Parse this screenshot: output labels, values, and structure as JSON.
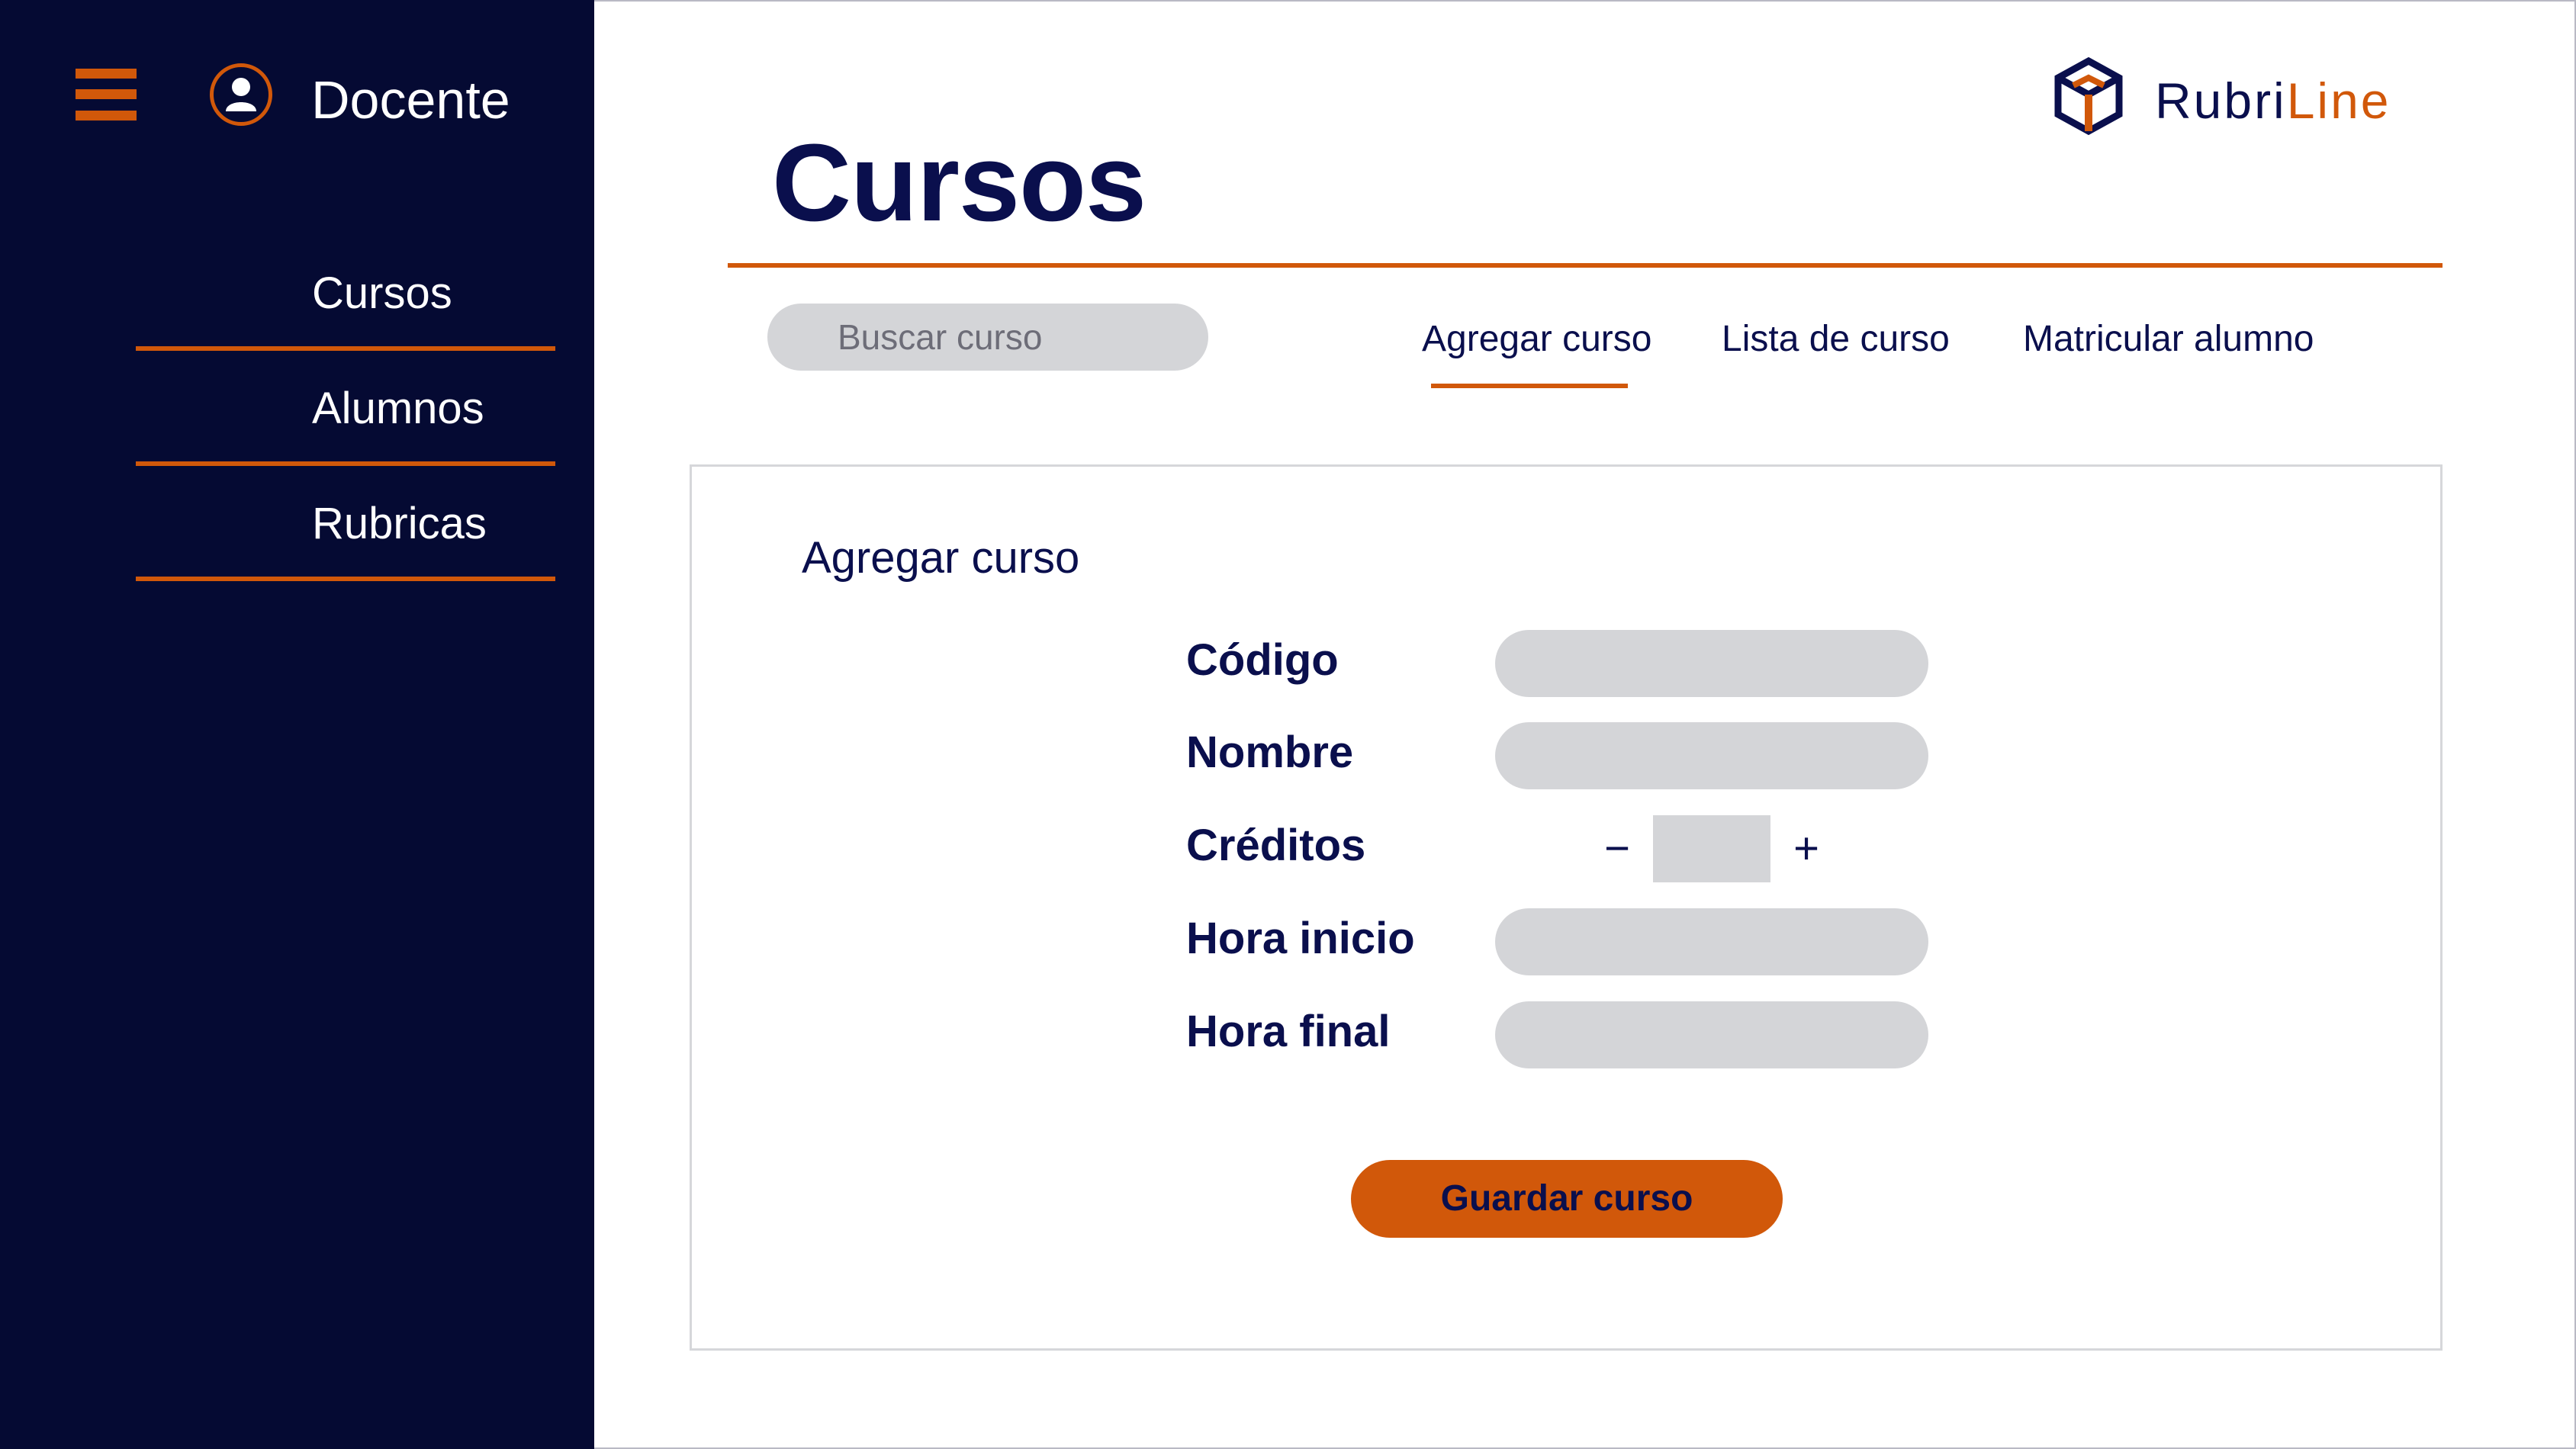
{
  "sidebar": {
    "role": "Docente",
    "items": [
      {
        "label": "Cursos"
      },
      {
        "label": "Alumnos"
      },
      {
        "label": "Rubricas"
      }
    ]
  },
  "header": {
    "title": "Cursos",
    "logo": {
      "part1": "Rubri",
      "part2": "Line"
    }
  },
  "search": {
    "placeholder": "Buscar curso"
  },
  "tabs": [
    {
      "label": "Agregar curso",
      "active": true
    },
    {
      "label": "Lista de curso",
      "active": false
    },
    {
      "label": "Matricular alumno",
      "active": false
    }
  ],
  "form": {
    "title": "Agregar curso",
    "fields": [
      {
        "label": "Código",
        "value": ""
      },
      {
        "label": "Nombre",
        "value": ""
      },
      {
        "label": "Créditos",
        "value": ""
      },
      {
        "label": "Hora inicio",
        "value": ""
      },
      {
        "label": "Hora final",
        "value": ""
      }
    ],
    "stepper": {
      "minus": "−",
      "plus": "+"
    },
    "save_label": "Guardar curso"
  },
  "colors": {
    "sidebar_bg": "#050a33",
    "accent": "#d1580a",
    "text_primary": "#0a0f4d",
    "input_bg": "#d4d5d8"
  }
}
